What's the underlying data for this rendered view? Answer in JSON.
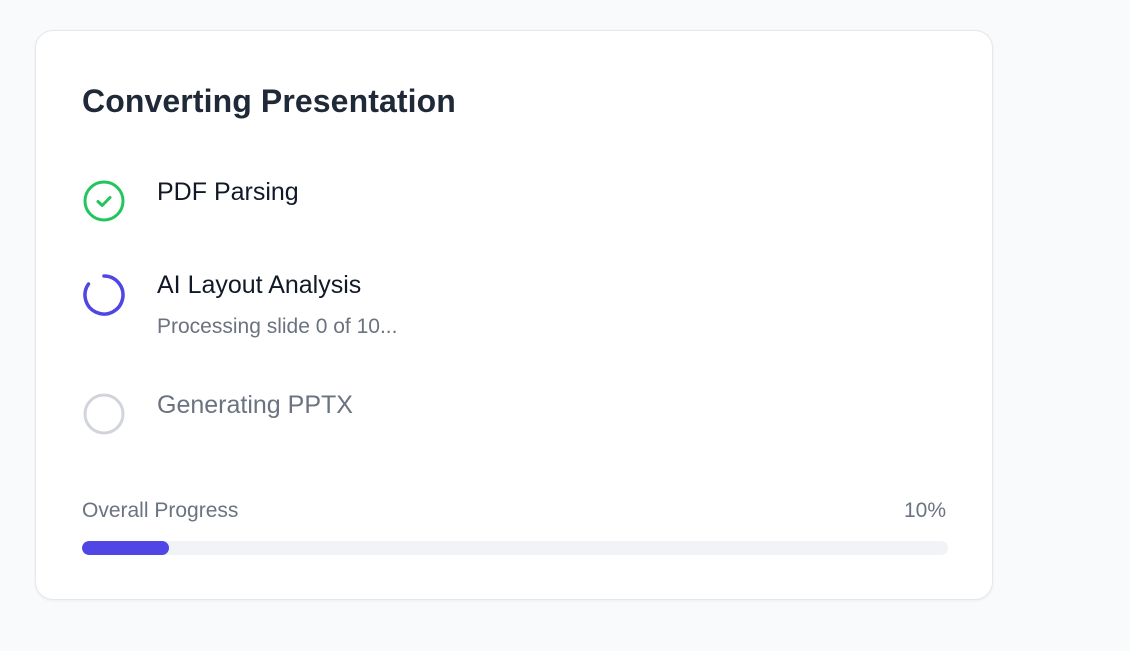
{
  "card": {
    "title": "Converting Presentation"
  },
  "steps": [
    {
      "label": "PDF Parsing",
      "status": "complete",
      "icon": "check-circle-icon"
    },
    {
      "label": "AI Layout Analysis",
      "sublabel": "Processing slide 0 of 10...",
      "status": "in-progress",
      "icon": "spinner-icon"
    },
    {
      "label": "Generating PPTX",
      "status": "pending",
      "icon": "empty-circle-icon"
    }
  ],
  "progress": {
    "label": "Overall Progress",
    "percent_text": "10%",
    "value": 0.1
  },
  "colors": {
    "complete": "#22c55e",
    "active": "#4f46e5",
    "pending": "#d1d5db",
    "fill": "#4f46e5"
  }
}
